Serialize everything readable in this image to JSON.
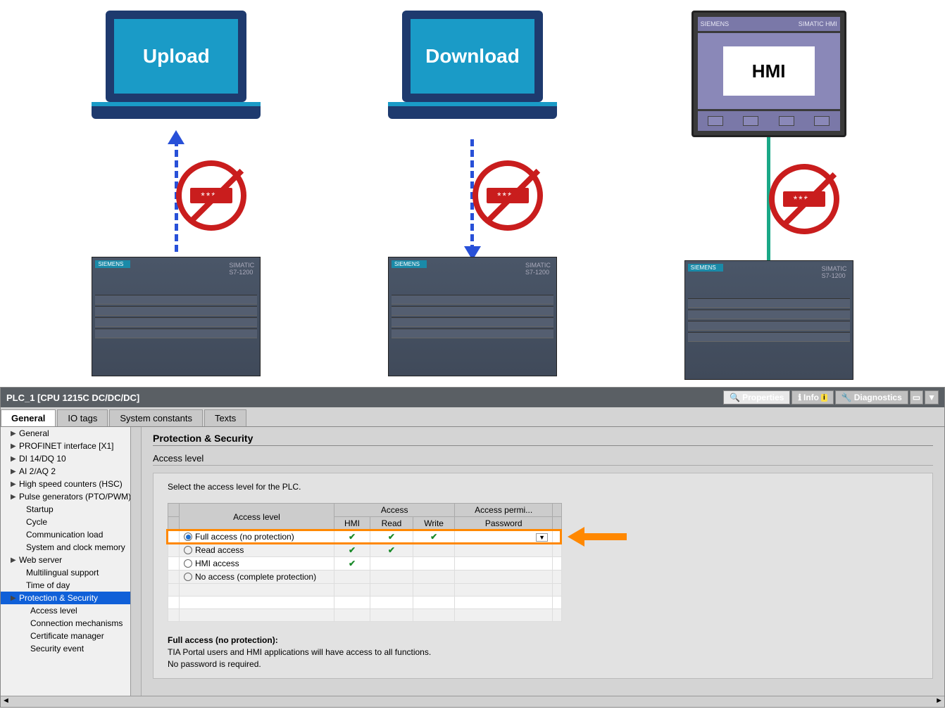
{
  "diagram": {
    "laptop1_label": "Upload",
    "laptop2_label": "Download",
    "hmi_label": "HMI",
    "hmi_brand": "SIEMENS",
    "hmi_model": "SIMATIC HMI",
    "pwd_mask": "****"
  },
  "window": {
    "title": "PLC_1 [CPU 1215C DC/DC/DC]",
    "top_tabs": {
      "properties": "Properties",
      "info": "Info",
      "diagnostics": "Diagnostics"
    },
    "main_tabs": {
      "general": "General",
      "io_tags": "IO tags",
      "system_constants": "System constants",
      "texts": "Texts"
    }
  },
  "sidebar": {
    "items": [
      {
        "label": "General",
        "arrow": true
      },
      {
        "label": "PROFINET interface [X1]",
        "arrow": true
      },
      {
        "label": "DI 14/DQ 10",
        "arrow": true
      },
      {
        "label": "AI 2/AQ 2",
        "arrow": true
      },
      {
        "label": "High speed counters (HSC)",
        "arrow": true
      },
      {
        "label": "Pulse generators (PTO/PWM)",
        "arrow": true
      },
      {
        "label": "Startup",
        "indent": true
      },
      {
        "label": "Cycle",
        "indent": true
      },
      {
        "label": "Communication load",
        "indent": true
      },
      {
        "label": "System and clock memory",
        "indent": true
      },
      {
        "label": "Web server",
        "arrow": true
      },
      {
        "label": "Multilingual support",
        "indent": true
      },
      {
        "label": "Time of day",
        "indent": true
      },
      {
        "label": "Protection & Security",
        "arrow": true,
        "selected": true
      },
      {
        "label": "Access level",
        "indent": true,
        "indent2": true
      },
      {
        "label": "Connection mechanisms",
        "indent": true,
        "indent2": true
      },
      {
        "label": "Certificate manager",
        "indent": true,
        "indent2": true
      },
      {
        "label": "Security event",
        "indent": true,
        "indent2": true
      }
    ]
  },
  "panel": {
    "heading": "Protection & Security",
    "subheading": "Access level",
    "instruction": "Select the access level for the PLC.",
    "table": {
      "headers": {
        "col_access_level": "Access level",
        "col_access": "Access",
        "col_perm": "Access permi...",
        "sub_hmi": "HMI",
        "sub_read": "Read",
        "sub_write": "Write",
        "sub_password": "Password"
      },
      "rows": [
        {
          "label": "Full access (no protection)",
          "selected": true,
          "hmi": true,
          "read": true,
          "write": true,
          "pwd_dd": true
        },
        {
          "label": "Read access",
          "selected": false,
          "hmi": true,
          "read": true,
          "write": false
        },
        {
          "label": "HMI access",
          "selected": false,
          "hmi": true,
          "read": false,
          "write": false
        },
        {
          "label": "No access (complete protection)",
          "selected": false,
          "hmi": false,
          "read": false,
          "write": false
        }
      ]
    },
    "footer_title": "Full access (no protection):",
    "footer_line1": "TIA Portal users and HMI applications will have access to all functions.",
    "footer_line2": "No password is required."
  }
}
